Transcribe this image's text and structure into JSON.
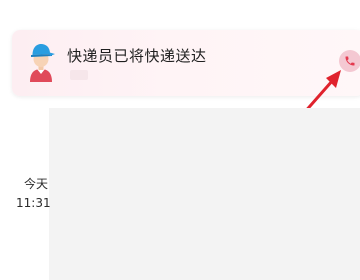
{
  "notification": {
    "title": "快递员已将快递送达"
  },
  "timeline": {
    "day_label": "今天",
    "time_label": "11:31"
  },
  "icons": {
    "avatar": "courier-avatar-icon",
    "phone": "phone-icon",
    "annotation": "red-arrow-icon"
  },
  "colors": {
    "card_background": "#fdeef2",
    "phone_button": "#f4c8d2",
    "phone_icon": "#e4394f",
    "arrow": "#e0222d",
    "panel": "#f3f3f3"
  }
}
